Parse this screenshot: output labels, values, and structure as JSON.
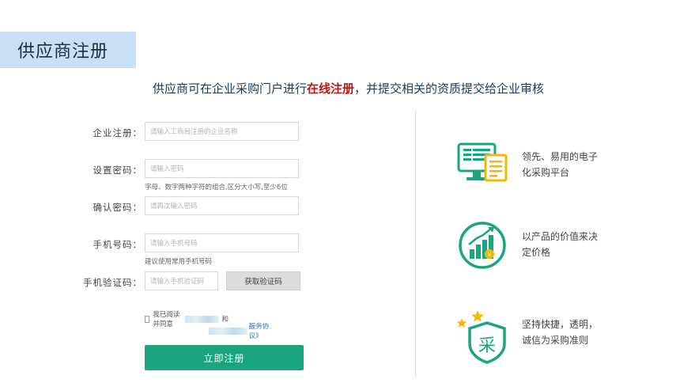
{
  "header": {
    "title": "供应商注册",
    "subtitle_pre": "供应商可在企业采购门户进行",
    "subtitle_highlight": "在线注册",
    "subtitle_post": "，并提交相关的资质提交给企业审核"
  },
  "form": {
    "company": {
      "label": "企业注册：",
      "placeholder": "请输入工商局注册的企业名称"
    },
    "password": {
      "label": "设置密码：",
      "placeholder": "请输入密码",
      "hint": "字母、数字两种字符的组合,区分大小写,至少6位"
    },
    "confirm": {
      "label": "确认密码：",
      "placeholder": "请再次输入密码"
    },
    "phone": {
      "label": "手机号码：",
      "placeholder": "请输入手机号码",
      "hint": "建议使用常用手机号码"
    },
    "sms": {
      "label": "手机验证码：",
      "placeholder": "请输入手机验证码",
      "button": "获取验证码"
    },
    "agreement": {
      "prefix": "我已阅读并同意",
      "and": "和",
      "link": "服务协议》"
    },
    "submit": "立即注册"
  },
  "features": [
    {
      "icon": "computer-document-icon",
      "line1": "领先、易用的电子",
      "line2": "化采购平台"
    },
    {
      "icon": "growth-chart-icon",
      "line1": "以产品的价值来决",
      "line2": "定价格"
    },
    {
      "icon": "purchase-shield-icon",
      "line1": "坚持快捷，透明，",
      "line2": "诚信为采购准则"
    }
  ],
  "shield_char": "采",
  "colors": {
    "accent": "#1aa57f",
    "highlight": "#c0141b",
    "banner": "#c9dff5",
    "star": "#f5b800"
  }
}
